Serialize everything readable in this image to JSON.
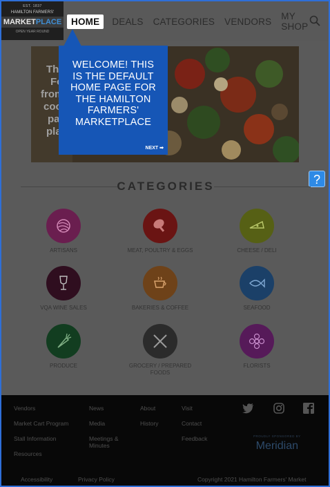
{
  "header": {
    "logo": {
      "est": "EST. 1837",
      "top": "HAMILTON FARMERS'",
      "market": "MARKET",
      "place": "PLACE",
      "bottom": "OPEN YEAR ROUND"
    },
    "nav": [
      "HOME",
      "DEALS",
      "CATEGORIES",
      "VENDORS",
      "MY SHOP"
    ],
    "search_icon": "search-icon"
  },
  "hero": {
    "partial_text": [
      "Th",
      "Fo",
      "from",
      "coo",
      "pa",
      "pla"
    ]
  },
  "tour": {
    "message": "WELCOME! THIS IS THE DEFAULT HOME PAGE FOR THE HAMILTON FARMERS' MARKETPLACE",
    "next_label": "NEXT ➡"
  },
  "help_button": "?",
  "categories": {
    "heading": "CATEGORIES",
    "items": [
      {
        "label": "ARTISANS",
        "color": "#c33690",
        "icon": "yarn-icon"
      },
      {
        "label": "MEAT, POULTRY & EGGS",
        "color": "#b8221f",
        "icon": "drumstick-icon"
      },
      {
        "label": "CHEESE / DELI",
        "color": "#92a61b",
        "icon": "cheese-icon"
      },
      {
        "label": "VQA WINE SALES",
        "color": "#4b1530",
        "icon": "wine-glass-icon"
      },
      {
        "label": "BAKERIES & COFFEE",
        "color": "#c07327",
        "icon": "coffee-cup-icon"
      },
      {
        "label": "SEAFOOD",
        "color": "#2f72b5",
        "icon": "fish-icon"
      },
      {
        "label": "PRODUCE",
        "color": "#1f6a36",
        "icon": "carrot-icon"
      },
      {
        "label": "GROCERY / PREPARED FOODS",
        "color": "#474747",
        "icon": "utensils-icon"
      },
      {
        "label": "FLORISTS",
        "color": "#8d2a92",
        "icon": "flower-icon"
      }
    ]
  },
  "footer": {
    "col1": [
      "Vendors",
      "Market Cart Program",
      "Stall Information",
      "Resources"
    ],
    "col2": [
      "News",
      "Media",
      "Meetings & Minutes"
    ],
    "col3": [
      "About",
      "History"
    ],
    "col4": [
      "Visit",
      "Contact",
      "Feedback"
    ],
    "social": [
      "twitter-icon",
      "instagram-icon",
      "facebook-icon"
    ],
    "sponsor_small": "PROUDLY SPONSORED BY",
    "sponsor_name": "Meridian",
    "bottom": {
      "accessibility": "Accessibility",
      "privacy": "Privacy Policy",
      "copyright": "Copyright 2021 Hamilton Farmers' Market"
    }
  }
}
